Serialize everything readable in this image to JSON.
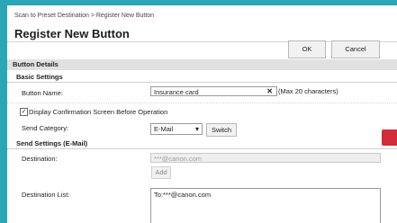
{
  "breadcrumb": "Scan to Preset Destination > Register New Button",
  "page_title": "Register New Button",
  "buttons": {
    "ok": "OK",
    "cancel": "Cancel",
    "switch": "Switch",
    "add": "Add"
  },
  "sections": {
    "button_details": "Button Details",
    "basic_settings": "Basic Settings",
    "send_settings": "Send Settings (E-Mail)"
  },
  "fields": {
    "button_name_label": "Button Name:",
    "button_name_value": "Insurance card",
    "button_name_note": "(Max 20 characters)",
    "confirm_label": "Display Confirmation Screen Before Operation",
    "send_category_label": "Send Category:",
    "send_category_value": "E-Mail",
    "destination_label": "Destination:",
    "destination_placeholder": "***@canon.com",
    "destination_list_label": "Destination List:",
    "destination_list_value": "To:***@canon.com"
  },
  "colors": {
    "background": "#2aa6b4",
    "accent_tab": "#d22b39"
  },
  "icons": {
    "clear": "close-icon",
    "dropdown": "chevron-down-icon",
    "check": "check-icon"
  }
}
